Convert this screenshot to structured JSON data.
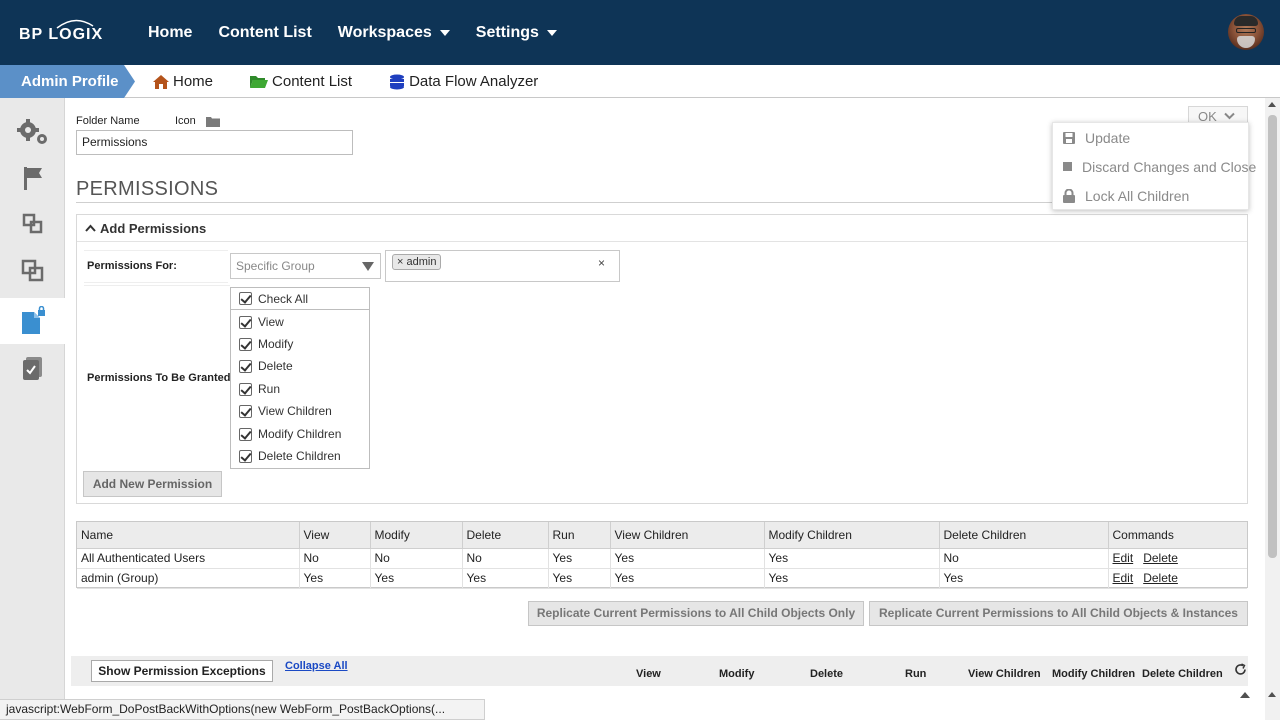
{
  "brand": {
    "logo_text": "BP LOGIX"
  },
  "topnav": {
    "items": [
      {
        "label": "Home",
        "has_caret": false
      },
      {
        "label": "Content List",
        "has_caret": false
      },
      {
        "label": "Workspaces",
        "has_caret": true
      },
      {
        "label": "Settings",
        "has_caret": true
      }
    ]
  },
  "subbar": {
    "crumb": "Admin Profile",
    "items": [
      {
        "label": "Home",
        "icon": "home-icon"
      },
      {
        "label": "Content List",
        "icon": "folder-open-icon"
      },
      {
        "label": "Data Flow Analyzer",
        "icon": "database-icon"
      }
    ]
  },
  "sidebar": {
    "items": [
      "gears-icon",
      "flag-icon",
      "link-squares-icon",
      "overlap-squares-icon",
      "locked-document-icon",
      "checklist-icon"
    ],
    "active_index": 4
  },
  "form": {
    "folder_name_label": "Folder Name",
    "icon_label": "Icon",
    "folder_name_value": "Permissions"
  },
  "permissions": {
    "title": "PERMISSIONS",
    "add_header": "Add Permissions",
    "for_label": "Permissions For:",
    "group_select": "Specific Group",
    "selected_tag": "admin",
    "tag_remove": "×",
    "granted_label": "Permissions To Be Granted",
    "check_all": "Check All",
    "checks": [
      "View",
      "Modify",
      "Delete",
      "Run",
      "View Children",
      "Modify Children",
      "Delete Children"
    ],
    "add_button": "Add New Permission"
  },
  "grid": {
    "columns": [
      "Name",
      "View",
      "Modify",
      "Delete",
      "Run",
      "View Children",
      "Modify Children",
      "Delete Children",
      "Commands"
    ],
    "rows": [
      [
        "All Authenticated Users",
        "No",
        "No",
        "No",
        "Yes",
        "Yes",
        "Yes",
        "No"
      ],
      [
        "admin (Group)",
        "Yes",
        "Yes",
        "Yes",
        "Yes",
        "Yes",
        "Yes",
        "Yes"
      ]
    ],
    "edit_label": "Edit",
    "delete_label": "Delete"
  },
  "replicate": {
    "child_only": "Replicate Current Permissions to All Child Objects Only",
    "child_and_instances": "Replicate Current Permissions to All Child Objects & Instances"
  },
  "exceptions": {
    "show_button": "Show Permission Exceptions",
    "collapse_link": "Collapse All",
    "columns": [
      "View",
      "Modify",
      "Delete",
      "Run",
      "View Children",
      "Modify Children",
      "Delete Children"
    ]
  },
  "ok_menu": {
    "button": "OK",
    "items": [
      {
        "label": "Update",
        "icon": "save-icon"
      },
      {
        "label": "Discard Changes and Close",
        "icon": "stop-icon"
      },
      {
        "label": "Lock All Children",
        "icon": "lock-icon"
      }
    ]
  },
  "statusbar": {
    "text": "javascript:WebForm_DoPostBackWithOptions(new WebForm_PostBackOptions(..."
  },
  "colors": {
    "topbar": "#0e3456",
    "crumb": "#5b90c8",
    "link": "#1a49c4"
  }
}
